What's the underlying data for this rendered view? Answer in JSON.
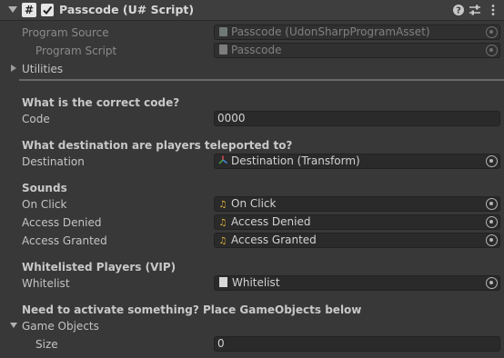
{
  "header": {
    "script_icon_glyph": "#",
    "title": "Passcode (U# Script)",
    "icons": [
      "fold-arrow-icon",
      "script-hash-icon",
      "checkbox-icon",
      "help-icon",
      "presets-icon",
      "context-menu-icon"
    ]
  },
  "program": {
    "source_label": "Program Source",
    "source_value": "Passcode (UdonSharpProgramAsset)",
    "script_label": "Program Script",
    "script_value": "Passcode"
  },
  "utilities_label": "Utilities",
  "code_section": {
    "heading": "What is the correct code?",
    "label": "Code",
    "value": "0000"
  },
  "destination_section": {
    "heading": "What destination are players teleported to?",
    "label": "Destination",
    "value": "Destination (Transform)"
  },
  "sounds_section": {
    "heading": "Sounds",
    "items": [
      {
        "label": "On Click",
        "value": "On Click"
      },
      {
        "label": "Access Denied",
        "value": "Access Denied"
      },
      {
        "label": "Access Granted",
        "value": "Access Granted"
      }
    ]
  },
  "whitelist_section": {
    "heading": "Whitelisted Players (VIP)",
    "label": "Whitelist",
    "value": "Whitelist"
  },
  "game_objects_section": {
    "heading": "Need to activate something? Place GameObjects below",
    "foldout_label": "Game Objects",
    "size_label": "Size",
    "size_value": "0"
  },
  "colors": {
    "background": "#383838",
    "header": "#3e3e3e",
    "field": "#2a2a2a",
    "audio_icon": "#e8b83a"
  }
}
